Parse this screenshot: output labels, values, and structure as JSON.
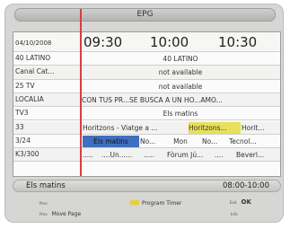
{
  "title": "EPG",
  "header": {
    "date": "04/10/2008",
    "times": [
      "09:30",
      "10:00",
      "10:30"
    ]
  },
  "channels": [
    {
      "name": "40 LATINO",
      "programs": [
        {
          "text": "40 LATINO"
        }
      ]
    },
    {
      "name": "Canal Cat...",
      "programs": [
        {
          "text": "not available"
        }
      ]
    },
    {
      "name": "25 TV",
      "programs": [
        {
          "text": "not available"
        }
      ]
    },
    {
      "name": "LOCALIA",
      "programs": [
        {
          "text": "CON TUS PR...SE BUSCA A UN HO...AMO..."
        }
      ]
    },
    {
      "name": "TV3",
      "programs": [
        {
          "text": "Els matins"
        }
      ]
    },
    {
      "name": "33",
      "programs": [
        {
          "text": "Horitzons - Viatge a ..."
        },
        {
          "text": "Horitzons..."
        },
        {
          "text": "Horit..."
        }
      ]
    },
    {
      "name": "3/24",
      "programs": [
        {
          "text": "Els matins"
        },
        {
          "text": "No..."
        },
        {
          "text": "Mon"
        },
        {
          "text": "No..."
        },
        {
          "text": "Tecnol..."
        }
      ]
    },
    {
      "name": "K3/300",
      "programs": [
        {
          "text": "....."
        },
        {
          "text": "....Un......"
        },
        {
          "text": "....."
        },
        {
          "text": "Fòrum Jú..."
        },
        {
          "text": "...."
        },
        {
          "text": "Beverl..."
        }
      ]
    }
  ],
  "status": {
    "program_title": "Els matins",
    "time_range": "08:00-10:00"
  },
  "help": {
    "key_top_left": "Prev",
    "key_bottom_left": "Prev",
    "move_page": "Move Page",
    "program_timer": "Program Timer",
    "key_top_right": "Exit",
    "ok": "OK",
    "info": "Info"
  },
  "colors": {
    "selected": "#3f6fc0",
    "highlight": "#e9e05a",
    "time_line": "#d44040"
  }
}
